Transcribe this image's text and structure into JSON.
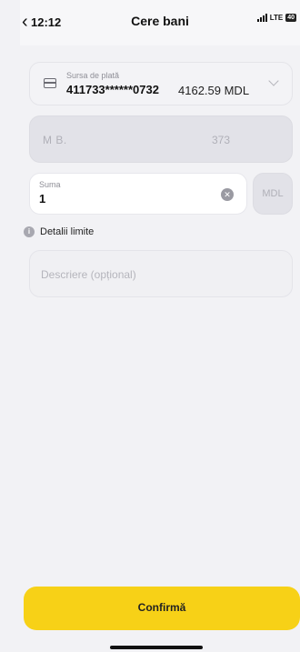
{
  "status_bar": {
    "time": "12:12",
    "network": "LTE",
    "battery": "40"
  },
  "header": {
    "back_icon": "‹",
    "title": "Cere bani"
  },
  "source": {
    "label": "Sursa de plată",
    "card_number": "411733******0732",
    "balance": "4162.59 MDL"
  },
  "recipient": {
    "name": "M      B.",
    "phone": "373"
  },
  "amount": {
    "label": "Suma",
    "value": "1",
    "currency": "MDL"
  },
  "limits": {
    "label": "Detalii limite"
  },
  "description": {
    "placeholder": "Descriere (opțional)"
  },
  "actions": {
    "confirm_label": "Confirmă"
  },
  "colors": {
    "accent": "#f7d117",
    "background": "#f2f2f5"
  }
}
